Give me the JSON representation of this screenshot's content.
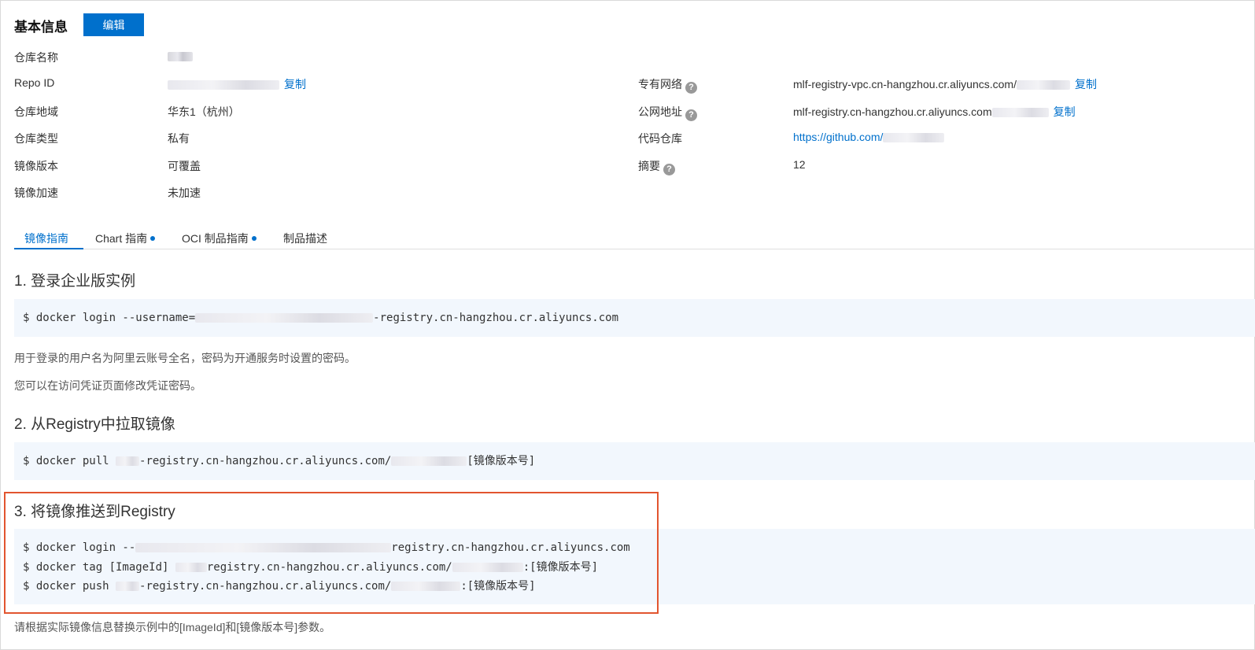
{
  "header": {
    "title": "基本信息",
    "edit_label": "编辑"
  },
  "left_info": [
    {
      "label": "仓库名称",
      "value": ""
    },
    {
      "label": "Repo ID",
      "value": "",
      "action": "复制"
    },
    {
      "label": "仓库地域",
      "value": "华东1（杭州）"
    },
    {
      "label": "仓库类型",
      "value": "私有"
    },
    {
      "label": "镜像版本",
      "value": "可覆盖"
    },
    {
      "label": "镜像加速",
      "value": "未加速"
    }
  ],
  "right_info": [
    {
      "label": "专有网络",
      "value": "mlf-registry-vpc.cn-hangzhou.cr.aliyuncs.com/",
      "action": "复制"
    },
    {
      "label": "公网地址",
      "value": "mlf-registry.cn-hangzhou.cr.aliyuncs.com",
      "action": "复制"
    },
    {
      "label": "代码仓库",
      "value": "https://github.com/"
    },
    {
      "label": "摘要",
      "value": "12"
    }
  ],
  "tabs": [
    {
      "label": "镜像指南",
      "active": true
    },
    {
      "label": "Chart 指南",
      "dot": true
    },
    {
      "label": "OCI 制品指南",
      "dot": true
    },
    {
      "label": "制品描述"
    }
  ],
  "sections": [
    {
      "title": "1. 登录企业版实例",
      "code": [
        {
          "pre": "$ docker login --username=",
          "post": "-registry.cn-hangzhou.cr.aliyuncs.com"
        }
      ],
      "notes": [
        "用于登录的用户名为阿里云账号全名，密码为开通服务时设置的密码。",
        "您可以在访问凭证页面修改凭证密码。"
      ]
    },
    {
      "title": "2. 从Registry中拉取镜像",
      "code": [
        {
          "pre": "$ docker pull ",
          "mid": "-registry.cn-hangzhou.cr.aliyuncs.com/",
          "post": "[镜像版本号]"
        }
      ]
    },
    {
      "title": "3. 将镜像推送到Registry",
      "code": [
        {
          "pre": "$ docker login --",
          "post": "registry.cn-hangzhou.cr.aliyuncs.com"
        },
        {
          "pre": "$ docker tag [ImageId] ",
          "mid": "registry.cn-hangzhou.cr.aliyuncs.com/",
          "post": ":[镜像版本号]"
        },
        {
          "pre": "$ docker push ",
          "mid": "-registry.cn-hangzhou.cr.aliyuncs.com/",
          "post": ":[镜像版本号]"
        }
      ]
    }
  ],
  "footer_note": "请根据实际镜像信息替换示例中的[ImageId]和[镜像版本号]参数。",
  "colors": {
    "accent": "#0070cc",
    "highlight": "#e2552f",
    "code_bg": "#f2f7fd"
  }
}
